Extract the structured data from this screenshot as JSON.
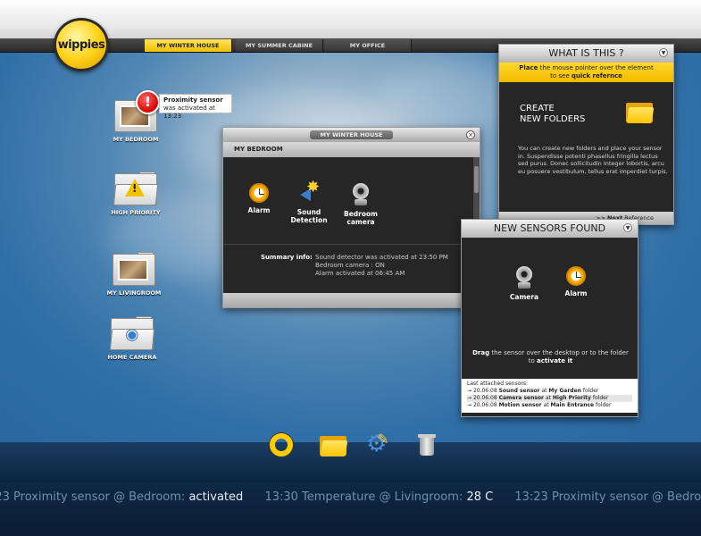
{
  "brand": {
    "logo_text": "wippies"
  },
  "tabs": [
    {
      "label": "MY WINTER HOUSE",
      "active": true
    },
    {
      "label": "MY SUMMER CABINE",
      "active": false
    },
    {
      "label": "MY OFFICE",
      "active": false
    }
  ],
  "notification": {
    "badge": "!",
    "title": "Proximity sensor",
    "text": "was activated at 13:23"
  },
  "desktop_icons": [
    {
      "label": "MY BEDROOM",
      "icon": "bedroom-photo-folder"
    },
    {
      "label": "HIGH PRIORITY",
      "icon": "warning-folder"
    },
    {
      "label": "MY LIVINGROOM",
      "icon": "livingroom-photo-folder"
    },
    {
      "label": "HOME CAMERA",
      "icon": "camera-folder"
    }
  ],
  "house_window": {
    "title": "MY WINTER HOUSE",
    "section": "MY BEDROOM",
    "sensors": [
      {
        "label_line1": "Alarm",
        "label_line2": "",
        "icon": "alarm-clock-icon"
      },
      {
        "label_line1": "Sound",
        "label_line2": "Detection",
        "icon": "sound-detection-icon"
      },
      {
        "label_line1": "Bedroom",
        "label_line2": "camera",
        "icon": "webcam-icon"
      }
    ],
    "summary_label": "Summary info:",
    "summary_lines": [
      "Sound detector was activated at 23:50 PM",
      "Bedroom camera : ON",
      "Alarm activated at 06:45 AM"
    ]
  },
  "help_panel": {
    "title": "WHAT IS THIS ?",
    "hint_line1_bold": "Place",
    "hint_line1_rest": " the mouse pointer  over the element",
    "hint_line2_rest": "to see ",
    "hint_line2_bold": "quick refernce",
    "heading_line1": "CREATE",
    "heading_line2": "NEW FOLDERS",
    "body": "You can create new folders and place your sensor in. Suspendisse potenti  phasellus fringilla lectus sed purus. Donec sollicitudin Integer lobortis, arcu eu posuere vestibulum, tellus erat imperdiet turpis.",
    "next_arrows": ">>",
    "next_bold": "Next",
    "next_rest": " Reference"
  },
  "sensors_panel": {
    "title": "NEW SENSORS FOUND",
    "sensors": [
      {
        "label": "Camera",
        "icon": "webcam-icon"
      },
      {
        "label": "Alarm",
        "icon": "alarm-clock-icon"
      }
    ],
    "drag_bold": "Drag",
    "drag_rest": " the sensor over the desktop or to the folder",
    "drag_line2_rest": "to ",
    "drag_line2_bold": "activate it",
    "attached_header": "Last attached sensors:",
    "attached": [
      {
        "date": "20.06.08",
        "sensor": "Sound sensor",
        "at": "at",
        "folder": "My Garden",
        "suffix": "folder"
      },
      {
        "date": "20.06.08",
        "sensor": "Camera sensor",
        "at": "at",
        "folder": "High Priority",
        "suffix": "folder"
      },
      {
        "date": "20.06.08",
        "sensor": "Motion sensor",
        "at": "at",
        "folder": "Main Entrance",
        "suffix": "folder"
      }
    ]
  },
  "dock": [
    {
      "name": "ring-icon"
    },
    {
      "name": "folder-icon"
    },
    {
      "name": "settings-pencil-icon"
    },
    {
      "name": "trash-icon"
    }
  ],
  "ticker": [
    {
      "text": ":23 Proximity sensor @ Bedroom: ",
      "value": "activated"
    },
    {
      "text": "13:30 Temperature @ Livingroom: ",
      "value": "28 C"
    },
    {
      "text": "13:23 Proximity sensor @ Bedroom: ",
      "value": "activated"
    }
  ],
  "colors": {
    "accent_yellow": "#ffd21a",
    "alert_red": "#d40000",
    "panel_dark": "#262626",
    "desktop_blue": "#2f6fa6"
  }
}
